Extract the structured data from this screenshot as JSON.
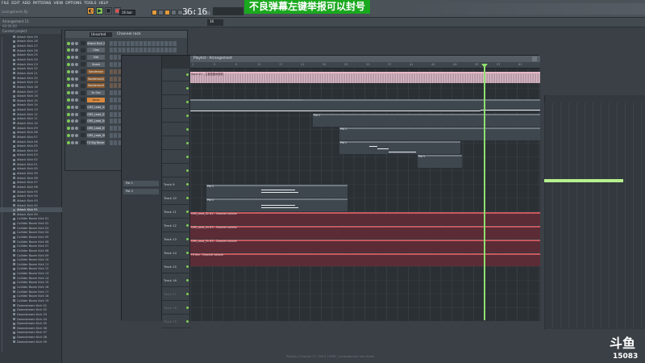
{
  "menu": [
    "FILE",
    "EDIT",
    "ADD",
    "PATTERNS",
    "VIEW",
    "OPTIONS",
    "TOOLS",
    "HELP"
  ],
  "song_title": "Lovingsheets.flp",
  "transport": {
    "time": "36:16",
    "time_suffix": "01",
    "pattern": "16 bar",
    "preset": "16"
  },
  "banner": {
    "text": "不良弹幕左键举报可以封号",
    "color": "#1aa81e"
  },
  "hint": {
    "line1": "Arrangement 11",
    "line2": "00:00:00"
  },
  "browser": {
    "header": "Current project",
    "items": [
      "Attack Kick 29",
      "Attack Kick 28",
      "Attack Kick 27",
      "Attack Kick 26",
      "Attack Kick 25",
      "Attack Kick 24",
      "Attack Kick 23",
      "Attack Kick 22",
      "Attack Kick 21",
      "Attack Kick 20",
      "Attack Kick 19",
      "Attack Kick 18",
      "Attack Kick 17",
      "Attack Kick 16",
      "Attack Kick 15",
      "Attack Kick 14",
      "Attack Kick 13",
      "Attack Kick 12",
      "Attack Kick 11",
      "Attack Kick 10",
      "Attack Kick 09",
      "Attack Kick 08",
      "Attack Kick 07",
      "Attack Kick 06",
      "Attack Kick 05",
      "Attack Kick 04",
      "Attack Kick 03",
      "Attack Kick 02",
      "Attack Kick 01",
      "Attack Kick 00",
      "Attack Kick 99",
      "Attack Kick 98",
      "Attack Kick 97",
      "Attack Kick 96",
      "Attack Kick 95",
      "Attack Kick 94",
      "Attack Kick 93",
      "Attack Kick 92",
      "Attack Kick 91",
      "Attack Kick 90",
      "Collider Boom Kick 01",
      "Collider Boom Kick 02",
      "Collider Boom Kick 03",
      "Collider Boom Kick 04",
      "Collider Boom Kick 05",
      "Collider Boom Kick 06",
      "Collider Boom Kick 07",
      "Collider Boom Kick 08",
      "Collider Boom Kick 09",
      "Collider Boom Kick 10",
      "Collider Boom Kick 11",
      "Collider Boom Kick 12",
      "Collider Boom Kick 13",
      "Collider Boom Kick 14",
      "Collider Boom Kick 15",
      "Collider Boom Kick 16",
      "Collider Boom Kick 17",
      "Collider Boom Kick 18",
      "Collider Boom Kick 19",
      "Downstream Kick 01",
      "Downstream Kick 02",
      "Downstream Kick 03",
      "Downstream Kick 04",
      "Downstream Kick 05",
      "Downstream Kick 06",
      "Downstream Kick 07",
      "Downstream Kick 08",
      "Downstream Kick 09"
    ],
    "selected_index": 38
  },
  "channel_rack": {
    "title": "Channel rack",
    "filter": "Unsorted",
    "channels": [
      {
        "name": "Attack Kick 26",
        "style": "grey"
      },
      {
        "name": "Clap",
        "style": "grey"
      },
      {
        "name": "Hat",
        "style": "grey"
      },
      {
        "name": "Snare",
        "style": "grey"
      },
      {
        "name": "Sanderson",
        "style": "brown"
      },
      {
        "name": "Sanderson2",
        "style": "brown"
      },
      {
        "name": "Sanderson3",
        "style": "brown"
      },
      {
        "name": "3x Osc",
        "style": "grey"
      },
      {
        "name": "Vocal",
        "style": "orange"
      },
      {
        "name": "CMS_Lead_02",
        "style": "grey"
      },
      {
        "name": "CMS_Lead_03",
        "style": "grey"
      },
      {
        "name": "CMS_Lead_04",
        "style": "grey"
      },
      {
        "name": "CMS_Lead_05",
        "style": "grey"
      },
      {
        "name": "CMS_Lead_06",
        "style": "grey"
      },
      {
        "name": "FX Big Reverse",
        "style": "grey"
      }
    ]
  },
  "playlist": {
    "title": "Playlist - Arrangement",
    "ruler": [
      "1",
      "5",
      "9",
      "13",
      "17",
      "21",
      "25",
      "29",
      "33",
      "37",
      "41",
      "45",
      "49",
      "53",
      "57",
      "61"
    ],
    "side_items": [
      "Pat 1",
      "Pat 2"
    ],
    "tracks": [
      "",
      "",
      "",
      "",
      "",
      "",
      "",
      "",
      "Track 9",
      "Track 10",
      "Track 11",
      "Track 12",
      "Track 13",
      "Track 14",
      "Track 15",
      "Track 16",
      "Track 17",
      "Track 18",
      "Track 19"
    ],
    "clip_labels": {
      "vocal": "Vocal #1 - 主播直播间音频",
      "t11": "CMS_Lead_02 #2 - Channel volume",
      "t12": "CMS_Lead_04 #3 - Channel volume",
      "t13": "CMS_Lead_05 #4 - Channel volume",
      "t16": "FX Rev - Channel volume",
      "pat": "Pat 1"
    }
  },
  "status": "Playlist | Channel 27 | Pat 5 | SYNC | arrangement and Audio",
  "watermark": {
    "logo": "斗鱼",
    "room": "15083"
  }
}
